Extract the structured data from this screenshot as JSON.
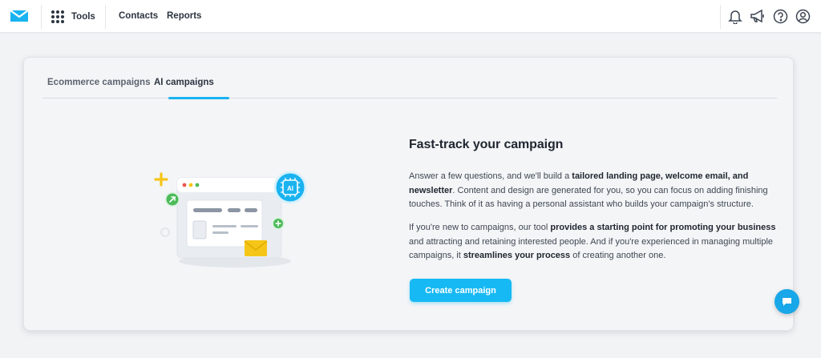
{
  "nav": {
    "tools_label": "Tools",
    "contacts_label": "Contacts",
    "reports_label": "Reports",
    "icons": [
      "notifications-bell-icon",
      "announcements-megaphone-icon",
      "help-icon",
      "account-icon"
    ]
  },
  "tabs": [
    {
      "label": "Ecommerce campaigns",
      "active": false
    },
    {
      "label": "AI campaigns",
      "active": true
    }
  ],
  "main": {
    "headline": "Fast-track your campaign",
    "p1": [
      {
        "t": "Answer a few questions, and we'll build a ",
        "bold": false
      },
      {
        "t": "tailored landing page, welcome email, and newsletter",
        "bold": true
      },
      {
        "t": ". Content and design are generated for you, so you can focus on adding finishing touches. Think of it as having a personal assistant who builds your campaign's structure.",
        "bold": false
      }
    ],
    "p2": [
      {
        "t": "If you're new to campaigns, our tool ",
        "bold": false
      },
      {
        "t": "provides a starting point for promoting your business",
        "bold": true
      },
      {
        "t": " and attracting and retaining interested people. And if you're experienced in managing multiple campaigns, it ",
        "bold": false
      },
      {
        "t": "streamlines your process",
        "bold": true
      },
      {
        "t": " of creating another one.",
        "bold": false
      }
    ],
    "cta_label": "Create campaign",
    "illustration_badge": "AI"
  },
  "colors": {
    "accent": "#17b9f4",
    "tab_underline": "#1ab3f0",
    "green": "#4cbb5a",
    "yellow": "#f5c518",
    "text_dark": "#1f2630"
  }
}
